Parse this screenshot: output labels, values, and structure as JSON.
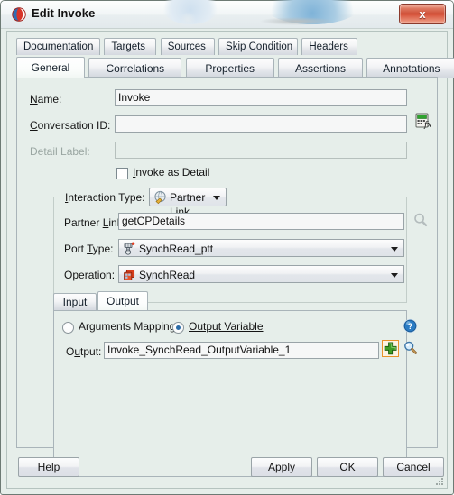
{
  "window": {
    "title": "Edit Invoke",
    "app_icon": "oracle-jdeveloper-icon",
    "close_label": "x"
  },
  "tabs_row1": [
    {
      "label": "Documentation",
      "selected": false
    },
    {
      "label": "Targets",
      "selected": false
    },
    {
      "label": "Sources",
      "selected": false
    },
    {
      "label": "Skip Condition",
      "selected": false
    },
    {
      "label": "Headers",
      "selected": false
    }
  ],
  "tabs_row2": [
    {
      "label": "General",
      "selected": true
    },
    {
      "label": "Correlations",
      "selected": false
    },
    {
      "label": "Properties",
      "selected": false
    },
    {
      "label": "Assertions",
      "selected": false
    },
    {
      "label": "Annotations",
      "selected": false
    }
  ],
  "general": {
    "name_label": "Name:",
    "name_value": "Invoke",
    "conversation_label": "Conversation ID:",
    "conversation_value": "",
    "conversation_placeholder": "",
    "expression_icon": "expression-builder-icon",
    "detail_label_label": "Detail Label:",
    "detail_label_value": "",
    "invoke_as_detail_label": "Invoke as Detail",
    "invoke_as_detail_checked": false
  },
  "interaction": {
    "group_label": "Interaction Type:",
    "type_icon": "partner-link-icon",
    "type_value": "Partner Link",
    "partner_link_label": "Partner Link:",
    "partner_link_value": "getCPDetails",
    "partner_link_browse_icon": "search-icon",
    "port_type_label": "Port Type:",
    "port_type_icon": "port-type-icon",
    "port_type_value": "SynchRead_ptt",
    "operation_label": "Operation:",
    "operation_icon": "operation-icon",
    "operation_value": "SynchRead"
  },
  "io": {
    "tabs": [
      {
        "label": "Input",
        "selected": false
      },
      {
        "label": "Output",
        "selected": true
      }
    ],
    "help_icon": "help-icon",
    "radio_arguments_mapping": "Arguments Mapping",
    "radio_output_variable": "Output Variable",
    "selected_radio": "Output Variable",
    "output_label": "Output:",
    "output_value": "Invoke_SynchRead_OutputVariable_1",
    "add_icon": "add-plus-icon",
    "browse_icon": "search-icon"
  },
  "footer": {
    "help": "Help",
    "apply": "Apply",
    "ok": "OK",
    "cancel": "Cancel"
  },
  "colors": {
    "dialog_background": "#e6eeea",
    "field_background": "#f6f7f7",
    "accent_blue": "#2b6ca8",
    "close_red": "#cd4b33",
    "add_green": "#3f9e24",
    "focus_orange": "#e8922a"
  }
}
